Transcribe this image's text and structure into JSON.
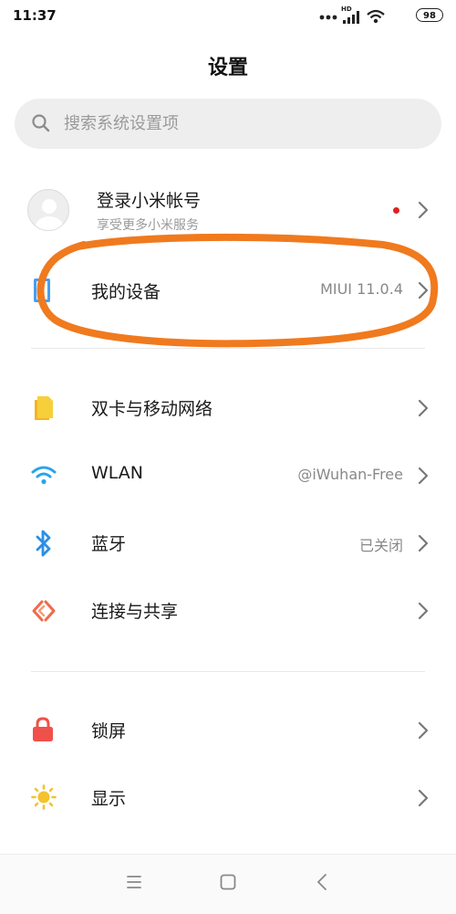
{
  "status_bar": {
    "time": "11:37",
    "network": "HD",
    "battery": "98"
  },
  "page": {
    "title": "设置"
  },
  "search": {
    "placeholder": "搜索系统设置项"
  },
  "account": {
    "title": "登录小米帐号",
    "subtitle": "享受更多小米服务",
    "has_notification": true
  },
  "device": {
    "label": "我的设备",
    "value": "MIUI 11.0.4"
  },
  "network_section": [
    {
      "label": "双卡与移动网络",
      "value": "",
      "icon": "sim-card-icon",
      "color": "#f5c22b"
    },
    {
      "label": "WLAN",
      "value": "@iWuhan-Free",
      "icon": "wifi-icon",
      "color": "#2aa4ea"
    },
    {
      "label": "蓝牙",
      "value": "已关闭",
      "icon": "bluetooth-icon",
      "color": "#2b8fe8"
    },
    {
      "label": "连接与共享",
      "value": "",
      "icon": "connection-sharing-icon",
      "color": "#f06a4a"
    }
  ],
  "display_section": [
    {
      "label": "锁屏",
      "value": "",
      "icon": "lock-icon",
      "color": "#f0504a"
    },
    {
      "label": "显示",
      "value": "",
      "icon": "sun-icon",
      "color": "#f5c22b"
    }
  ],
  "colors": {
    "highlight": "#f07a1e",
    "accent_blue": "#2aa4ea"
  },
  "nav_bar": [
    "menu-icon",
    "home-icon",
    "back-icon"
  ]
}
